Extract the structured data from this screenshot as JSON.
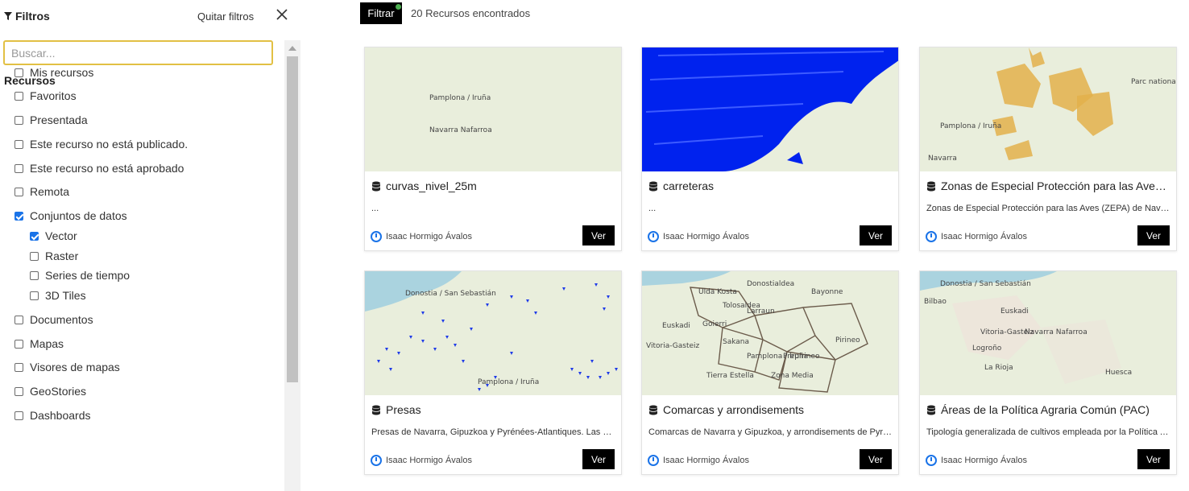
{
  "sidebar": {
    "title": "Filtros",
    "clear_label": "Quitar filtros",
    "search_placeholder": "Buscar...",
    "section_title": "Recursos",
    "items": [
      {
        "label": "Mis recursos",
        "checked": false,
        "indent": 0
      },
      {
        "label": "Favoritos",
        "checked": false,
        "indent": 0
      },
      {
        "label": "Presentada",
        "checked": false,
        "indent": 0
      },
      {
        "label": "Este recurso no está publicado.",
        "checked": false,
        "indent": 0
      },
      {
        "label": "Este recurso no está aprobado",
        "checked": false,
        "indent": 0
      },
      {
        "label": "Remota",
        "checked": false,
        "indent": 0
      },
      {
        "label": "Conjuntos de datos",
        "checked": true,
        "indent": 0
      },
      {
        "label": "Vector",
        "checked": true,
        "indent": 1
      },
      {
        "label": "Raster",
        "checked": false,
        "indent": 1
      },
      {
        "label": "Series de tiempo",
        "checked": false,
        "indent": 1
      },
      {
        "label": "3D Tiles",
        "checked": false,
        "indent": 1
      },
      {
        "label": "Documentos",
        "checked": false,
        "indent": 0
      },
      {
        "label": "Mapas",
        "checked": false,
        "indent": 0
      },
      {
        "label": "Visores de mapas",
        "checked": false,
        "indent": 0
      },
      {
        "label": "GeoStories",
        "checked": false,
        "indent": 0
      },
      {
        "label": "Dashboards",
        "checked": false,
        "indent": 0
      }
    ]
  },
  "toolbar": {
    "filter_label": "Filtrar",
    "results_text": "20 Recursos encontrados"
  },
  "cards": [
    {
      "title": "curvas_nivel_25m",
      "description": "...",
      "owner": "Isaac Hormigo Ávalos",
      "view_label": "Ver",
      "map_labels": [
        "Pamplona / Iruña",
        "Navarra Nafarroa"
      ]
    },
    {
      "title": "carreteras",
      "description": "...",
      "owner": "Isaac Hormigo Ávalos",
      "view_label": "Ver",
      "map_labels": []
    },
    {
      "title": "Zonas de Especial Protección para las Aves (ZEPA)",
      "description": "Zonas de Especial Protección para las Aves (ZEPA) de Navarra",
      "owner": "Isaac Hormigo Ávalos",
      "view_label": "Ver",
      "map_labels": [
        "Pamplona / Iruña",
        "Parc national des Pyrénées (Aire d'adhésion)",
        "Navarra"
      ]
    },
    {
      "title": "Presas",
      "description": "Presas de Navarra, Gipuzkoa y Pyrénées-Atlantiques. Las presas",
      "owner": "Isaac Hormigo Ávalos",
      "view_label": "Ver",
      "map_labels": [
        "Donostia / San Sebastián",
        "Pamplona / Iruña"
      ]
    },
    {
      "title": "Comarcas y arrondisements",
      "description": "Comarcas de Navarra y Gipuzkoa, y arrondisements de Pyrénées-Atlantiques",
      "owner": "Isaac Hormigo Ávalos",
      "view_label": "Ver",
      "map_labels": [
        "Ulda Kosta",
        "Donostialdea",
        "Bayonne",
        "Tolosaldea",
        "Larraun",
        "Goierri",
        "Sakana",
        "Pamplona / Iruña",
        "Pirineo",
        "Tierra Estella",
        "Zona Media",
        "Prepirineo",
        "Vitoria-Gasteiz",
        "Euskadi"
      ]
    },
    {
      "title": "Áreas de la Política Agraria Común (PAC)",
      "description": "Tipología generalizada de cultivos empleada por la Política Agraria Común",
      "owner": "Isaac Hormigo Ávalos",
      "view_label": "Ver",
      "map_labels": [
        "Donostia / San Sebastián",
        "Bilbao",
        "Euskadi",
        "Vitoria-Gasteiz",
        "Navarra Nafarroa",
        "Logroño",
        "La Rioja",
        "Huesca"
      ]
    }
  ]
}
